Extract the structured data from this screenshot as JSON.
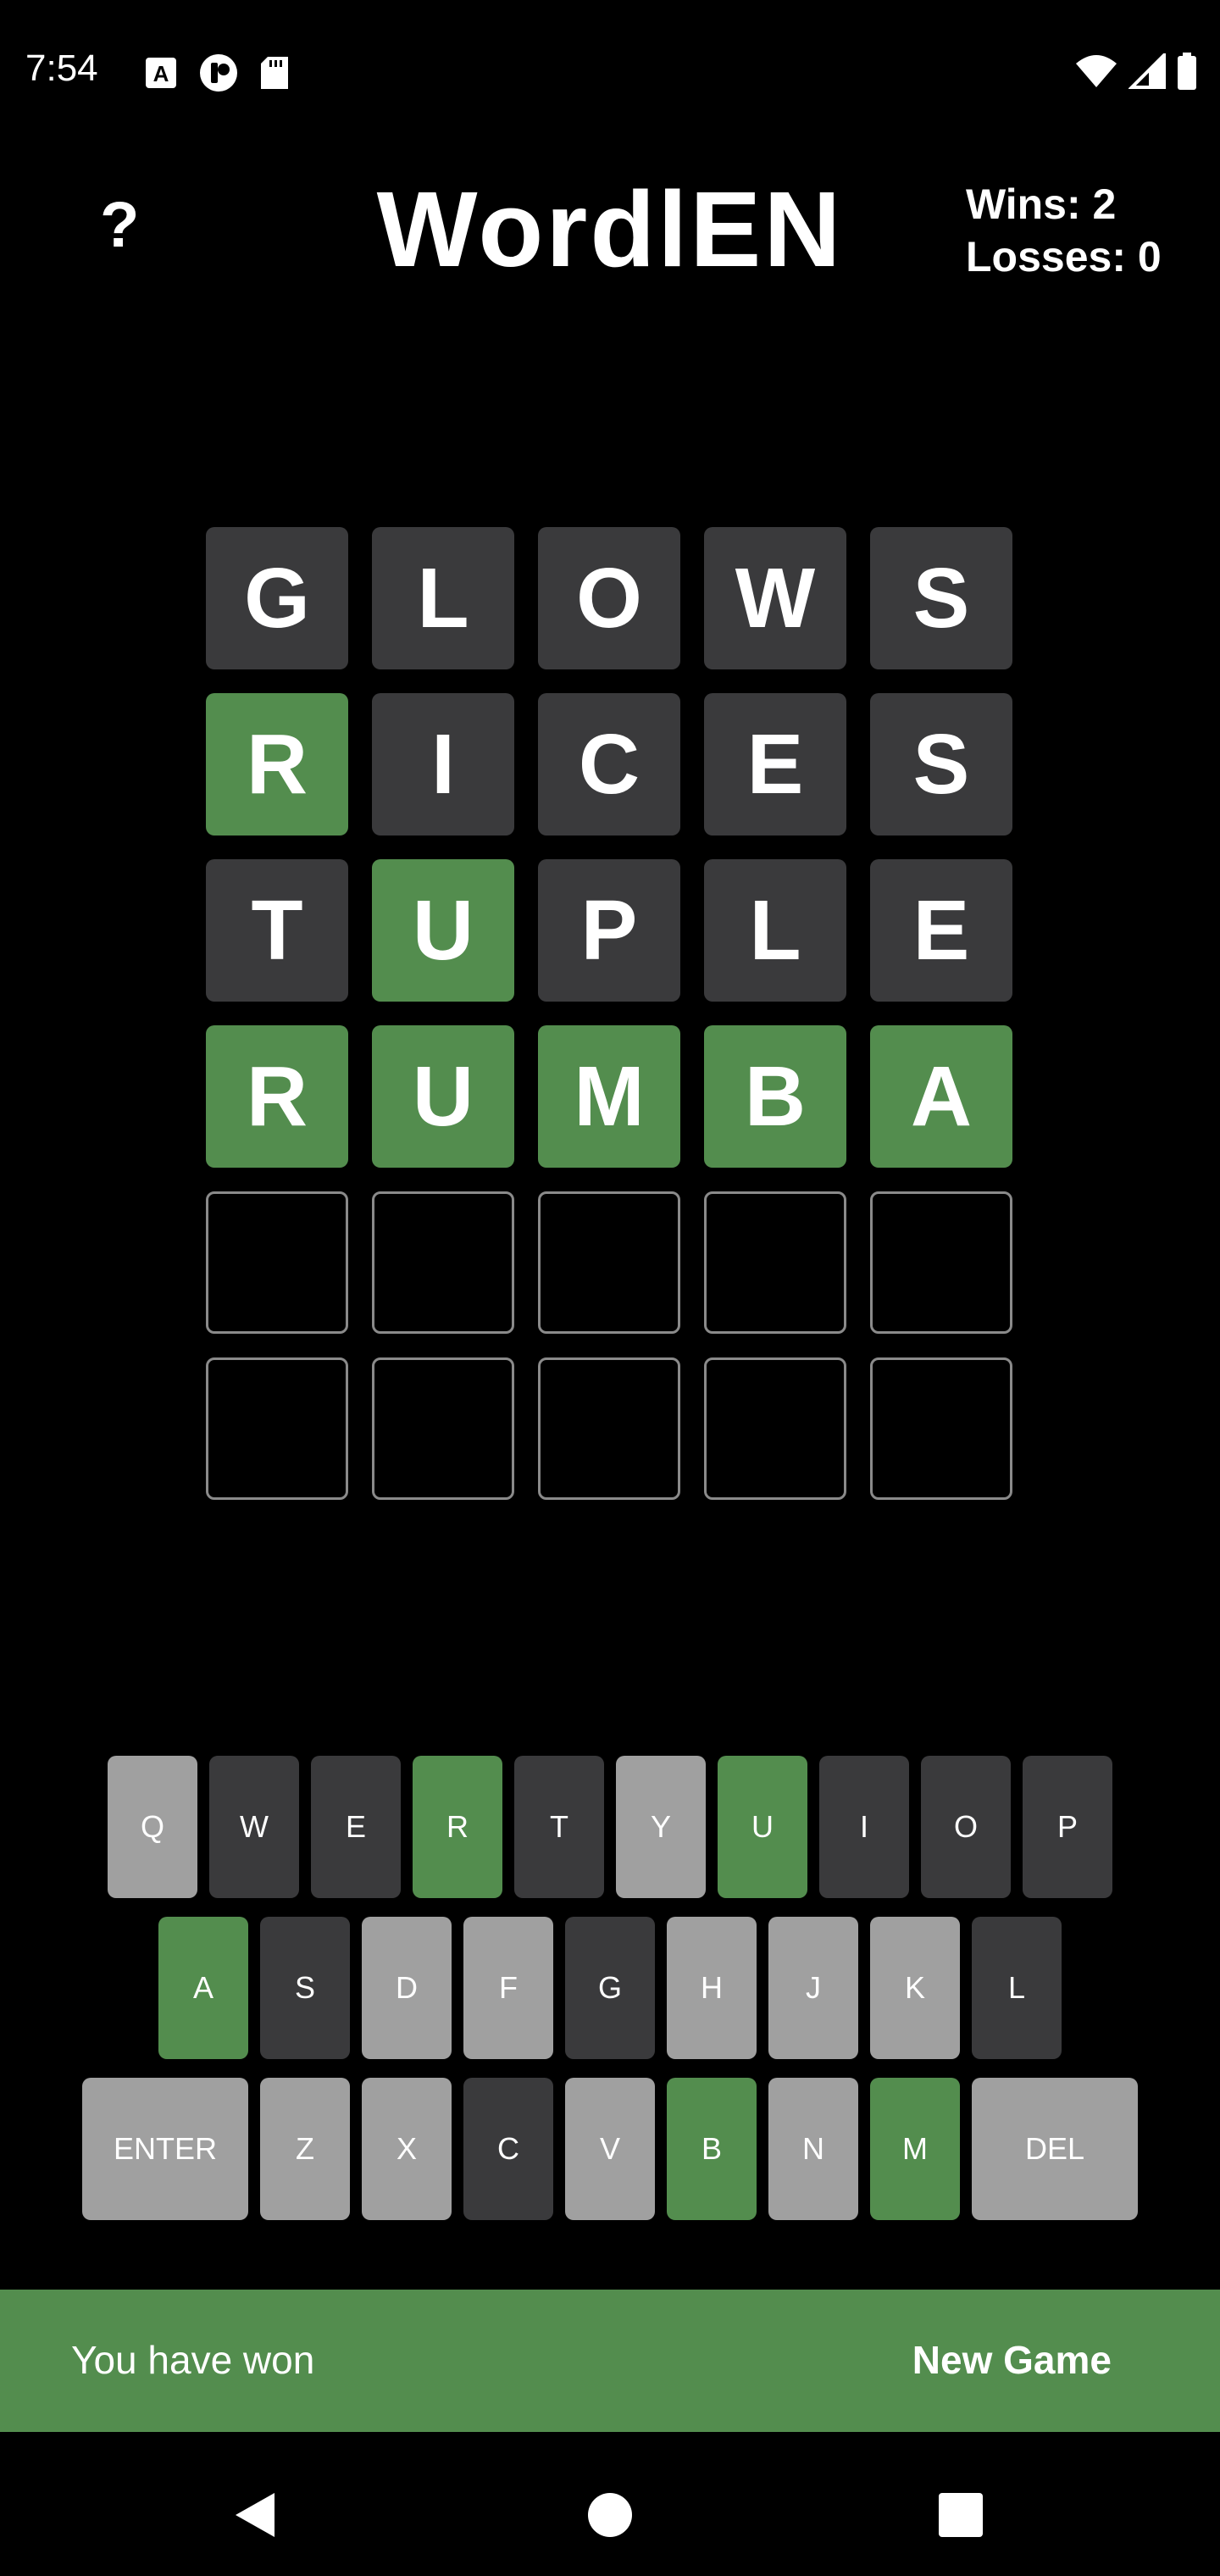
{
  "status_bar": {
    "time": "7:54",
    "icons_left": [
      "font-app-icon",
      "pinterest-icon",
      "sd-card-icon"
    ],
    "icons_right": [
      "wifi-icon",
      "signal-icon",
      "battery-icon"
    ]
  },
  "header": {
    "help_label": "?",
    "title": "WordlEN",
    "wins": "Wins: 2",
    "losses": "Losses: 0"
  },
  "board": {
    "rows": [
      [
        {
          "letter": "G",
          "state": "absent"
        },
        {
          "letter": "L",
          "state": "absent"
        },
        {
          "letter": "O",
          "state": "absent"
        },
        {
          "letter": "W",
          "state": "absent"
        },
        {
          "letter": "S",
          "state": "absent"
        }
      ],
      [
        {
          "letter": "R",
          "state": "correct"
        },
        {
          "letter": "I",
          "state": "absent"
        },
        {
          "letter": "C",
          "state": "absent"
        },
        {
          "letter": "E",
          "state": "absent"
        },
        {
          "letter": "S",
          "state": "absent"
        }
      ],
      [
        {
          "letter": "T",
          "state": "absent"
        },
        {
          "letter": "U",
          "state": "correct"
        },
        {
          "letter": "P",
          "state": "absent"
        },
        {
          "letter": "L",
          "state": "absent"
        },
        {
          "letter": "E",
          "state": "absent"
        }
      ],
      [
        {
          "letter": "R",
          "state": "correct"
        },
        {
          "letter": "U",
          "state": "correct"
        },
        {
          "letter": "M",
          "state": "correct"
        },
        {
          "letter": "B",
          "state": "correct"
        },
        {
          "letter": "A",
          "state": "correct"
        }
      ],
      [
        {
          "letter": "",
          "state": "empty"
        },
        {
          "letter": "",
          "state": "empty"
        },
        {
          "letter": "",
          "state": "empty"
        },
        {
          "letter": "",
          "state": "empty"
        },
        {
          "letter": "",
          "state": "empty"
        }
      ],
      [
        {
          "letter": "",
          "state": "empty"
        },
        {
          "letter": "",
          "state": "empty"
        },
        {
          "letter": "",
          "state": "empty"
        },
        {
          "letter": "",
          "state": "empty"
        },
        {
          "letter": "",
          "state": "empty"
        }
      ]
    ]
  },
  "keyboard": {
    "rows": [
      [
        {
          "label": "Q",
          "state": "unused"
        },
        {
          "label": "W",
          "state": "absent"
        },
        {
          "label": "E",
          "state": "absent"
        },
        {
          "label": "R",
          "state": "correct"
        },
        {
          "label": "T",
          "state": "absent"
        },
        {
          "label": "Y",
          "state": "unused"
        },
        {
          "label": "U",
          "state": "correct"
        },
        {
          "label": "I",
          "state": "absent"
        },
        {
          "label": "O",
          "state": "absent"
        },
        {
          "label": "P",
          "state": "absent"
        }
      ],
      [
        {
          "label": "A",
          "state": "correct"
        },
        {
          "label": "S",
          "state": "absent"
        },
        {
          "label": "D",
          "state": "unused"
        },
        {
          "label": "F",
          "state": "unused"
        },
        {
          "label": "G",
          "state": "absent"
        },
        {
          "label": "H",
          "state": "unused"
        },
        {
          "label": "J",
          "state": "unused"
        },
        {
          "label": "K",
          "state": "unused"
        },
        {
          "label": "L",
          "state": "absent"
        }
      ],
      [
        {
          "label": "ENTER",
          "state": "unused",
          "wide": true
        },
        {
          "label": "Z",
          "state": "unused"
        },
        {
          "label": "X",
          "state": "unused"
        },
        {
          "label": "C",
          "state": "absent"
        },
        {
          "label": "V",
          "state": "unused"
        },
        {
          "label": "B",
          "state": "correct"
        },
        {
          "label": "N",
          "state": "unused"
        },
        {
          "label": "M",
          "state": "correct"
        },
        {
          "label": "DEL",
          "state": "unused",
          "wide": true
        }
      ]
    ]
  },
  "snackbar": {
    "message": "You have won",
    "action": "New Game"
  },
  "nav_bar": {
    "buttons": [
      "back-icon",
      "home-icon",
      "recents-icon"
    ]
  },
  "colors": {
    "correct": "#538d4e",
    "absent": "#3a3a3c",
    "unused": "#a0a0a0",
    "background": "#000000"
  }
}
